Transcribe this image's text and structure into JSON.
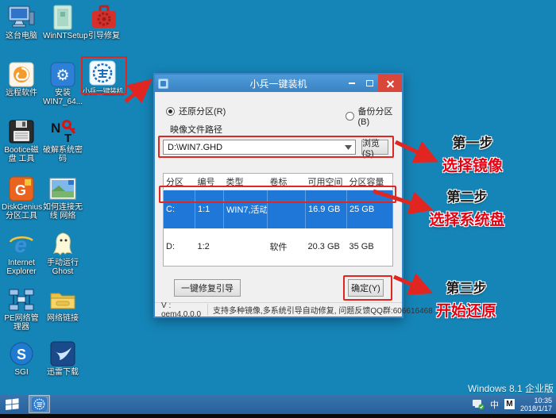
{
  "desktop": {
    "watermark": "Windows 8.1 企业版",
    "icons": [
      {
        "label": "这台电脑"
      },
      {
        "label": "WinNTSetup"
      },
      {
        "label": "引导修复"
      },
      {
        "label": "远程软件"
      },
      {
        "label": "安装 WIN7_64..."
      },
      {
        "label": "小兵一键装机"
      },
      {
        "label": "Bootice磁盘 工具"
      },
      {
        "label": "破解系统密码"
      },
      {
        "label": "DiskGenius 分区工具"
      },
      {
        "label": "如何连接无线 网络"
      },
      {
        "label": "Internet Explorer"
      },
      {
        "label": "手动运行 Ghost"
      },
      {
        "label": "PE网络管理器"
      },
      {
        "label": "网络链接"
      },
      {
        "label": "SGI"
      },
      {
        "label": "迅雷下载"
      }
    ]
  },
  "dialog": {
    "title": "小兵一键装机",
    "radio_restore": "还原分区(R)",
    "radio_backup": "备份分区(B)",
    "path_label": "映像文件路径",
    "path_value": "D:\\WIN7.GHD",
    "browse_label": "浏览(S)",
    "table": {
      "headers": [
        "分区",
        "编号",
        "类型",
        "卷标",
        "可用空间",
        "分区容量"
      ],
      "rows": [
        {
          "cells": [
            "C:",
            "1:1",
            "WIN7,活动",
            "",
            "16.9 GB",
            "25 GB"
          ]
        },
        {
          "cells": [
            "D:",
            "1:2",
            "",
            "软件",
            "20.3 GB",
            "35 GB"
          ]
        }
      ]
    },
    "repair_label": "一键修复引导",
    "ok_label": "确定(Y)",
    "version": "V : oem4.0.0.0",
    "status": "支持多种镜像,多系统引导自动修复, 问题反馈QQ群:606616468"
  },
  "annotations": [
    {
      "step": "第一步",
      "action": "选择镜像"
    },
    {
      "step": "第二步",
      "action": "选择系统盘"
    },
    {
      "step": "第三步",
      "action": "开始还原"
    }
  ],
  "taskbar": {
    "input_lang": "中",
    "ime_mode": "M",
    "time": "10:35",
    "date": "2018/1/17"
  },
  "glyphs": {
    "gear": "⚙",
    "ie": "e",
    "diskgenius": "G",
    "sgi": "S",
    "nt_n": "N",
    "nt_t": "T"
  },
  "colors": {
    "desktop": "#1585b8",
    "titlebar": "#3a83c5",
    "selected_row": "#1f78d8",
    "annotation_red": "#e60012",
    "highlight_box": "#e12520"
  }
}
